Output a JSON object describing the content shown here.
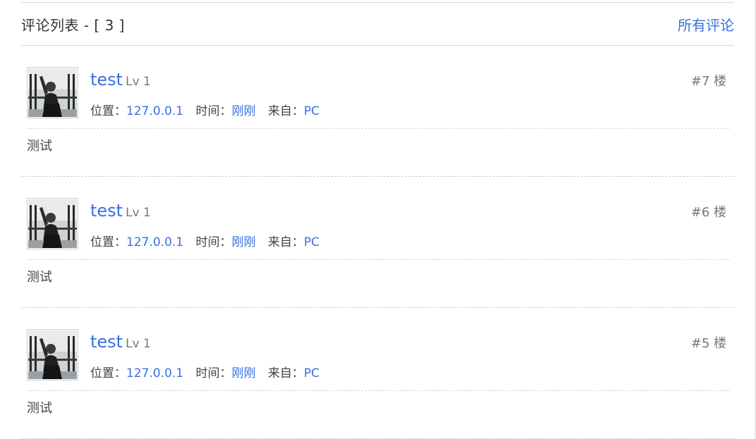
{
  "header": {
    "title": "评论列表 - [ 3 ]",
    "all_comments_link": "所有评论"
  },
  "labels": {
    "location": "位置：",
    "time": "时间：",
    "source": "来自："
  },
  "comments": [
    {
      "username": "test",
      "level": "Lv 1",
      "location": "127.0.0.1",
      "time": "刚刚",
      "source": "PC",
      "floor": "#7 楼",
      "content": "测试"
    },
    {
      "username": "test",
      "level": "Lv 1",
      "location": "127.0.0.1",
      "time": "刚刚",
      "source": "PC",
      "floor": "#6 楼",
      "content": "测试"
    },
    {
      "username": "test",
      "level": "Lv 1",
      "location": "127.0.0.1",
      "time": "刚刚",
      "source": "PC",
      "floor": "#5 楼",
      "content": "测试"
    }
  ],
  "colors": {
    "link": "#3a6fe0",
    "text": "#333333",
    "muted": "#777777",
    "divider": "#d6d6d6"
  }
}
